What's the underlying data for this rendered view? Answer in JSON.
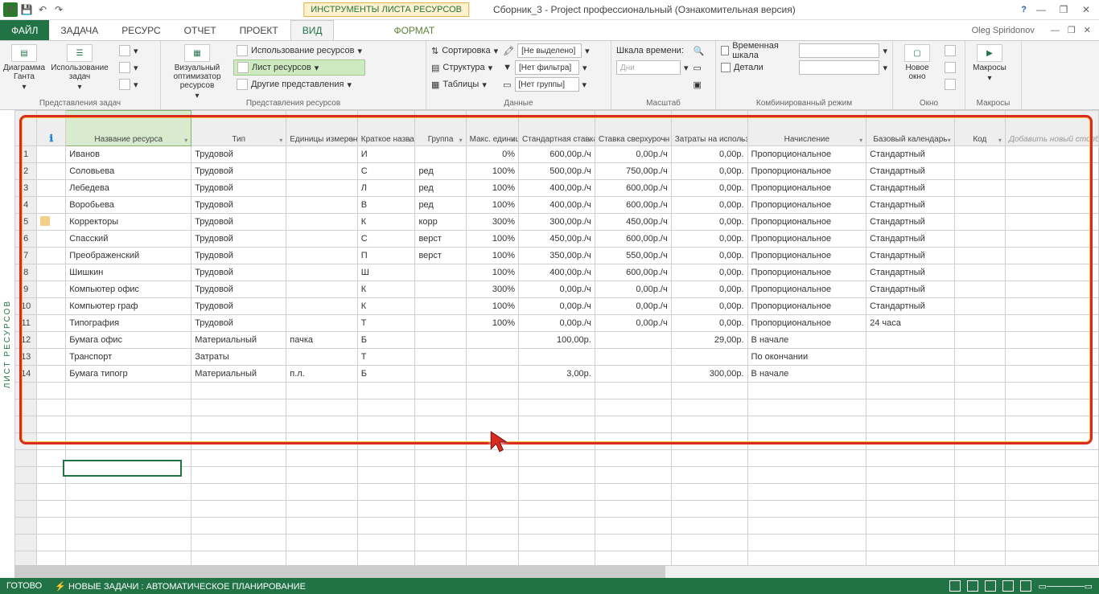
{
  "title": {
    "context_tab": "ИНСТРУМЕНТЫ ЛИСТА РЕСУРСОВ",
    "document": "Сборник_3 - Project профессиональный (Ознакомительная версия)"
  },
  "user": {
    "name": "Oleg Spiridonov"
  },
  "tabs": {
    "file": "ФАЙЛ",
    "items": [
      "ЗАДАЧА",
      "РЕСУРС",
      "ОТЧЕТ",
      "ПРОЕКТ",
      "ВИД",
      "",
      "ФОРМАТ"
    ]
  },
  "ribbon": {
    "g1": {
      "gantt": "Диаграмма Ганта",
      "usage": "Использование задач",
      "label": "Представления задач"
    },
    "g2": {
      "visual": "Визуальный оптимизатор ресурсов",
      "res_use": "Использование ресурсов",
      "res_sheet": "Лист ресурсов",
      "other": "Другие представления",
      "label": "Представления ресурсов"
    },
    "g3": {
      "sort": "Сортировка",
      "struct": "Структура",
      "tables": "Таблицы",
      "none": "[Не выделено]",
      "nofilter": "[Нет фильтра]",
      "nogroup": "[Нет группы]",
      "label": "Данные"
    },
    "g4": {
      "scale": "Шкала времени:",
      "days": "Дни",
      "label": "Масштаб"
    },
    "g5": {
      "timeline": "Временная шкала",
      "details": "Детали",
      "label": "Комбинированный режим"
    },
    "g6": {
      "new_window": "Новое окно",
      "label": "Окно"
    },
    "g7": {
      "macros": "Макросы",
      "label": "Макросы"
    }
  },
  "side": "ЛИСТ РЕСУРСОВ",
  "columns": [
    "",
    "",
    "Название ресурса",
    "Тип",
    "Единицы измерения материалов",
    "Краткое названи",
    "Группа",
    "Макс. единиц",
    "Стандартная ставка",
    "Ставка сверхурочн",
    "Затраты на использ.",
    "Начисление",
    "Базовый календарь",
    "Код",
    "Добавить новый столбец"
  ],
  "rows": [
    {
      "n": 1,
      "i": "",
      "name": "Иванов",
      "type": "Трудовой",
      "unit": "",
      "short": "И",
      "grp": "",
      "max": "0%",
      "std": "600,00р./ч",
      "over": "0,00р./ч",
      "cost": "0,00р.",
      "acc": "Пропорциональное",
      "cal": "Стандартный"
    },
    {
      "n": 2,
      "i": "",
      "name": "Соловьева",
      "type": "Трудовой",
      "unit": "",
      "short": "С",
      "grp": "ред",
      "max": "100%",
      "std": "500,00р./ч",
      "over": "750,00р./ч",
      "cost": "0,00р.",
      "acc": "Пропорциональное",
      "cal": "Стандартный"
    },
    {
      "n": 3,
      "i": "",
      "name": "Лебедева",
      "type": "Трудовой",
      "unit": "",
      "short": "Л",
      "grp": "ред",
      "max": "100%",
      "std": "400,00р./ч",
      "over": "600,00р./ч",
      "cost": "0,00р.",
      "acc": "Пропорциональное",
      "cal": "Стандартный"
    },
    {
      "n": 4,
      "i": "",
      "name": "Воробьева",
      "type": "Трудовой",
      "unit": "",
      "short": "В",
      "grp": "ред",
      "max": "100%",
      "std": "400,00р./ч",
      "over": "600,00р./ч",
      "cost": "0,00р.",
      "acc": "Пропорциональное",
      "cal": "Стандартный"
    },
    {
      "n": 5,
      "i": "ind",
      "name": "Корректоры",
      "type": "Трудовой",
      "unit": "",
      "short": "К",
      "grp": "корр",
      "max": "300%",
      "std": "300,00р./ч",
      "over": "450,00р./ч",
      "cost": "0,00р.",
      "acc": "Пропорциональное",
      "cal": "Стандартный"
    },
    {
      "n": 6,
      "i": "",
      "name": "Спасский",
      "type": "Трудовой",
      "unit": "",
      "short": "С",
      "grp": "верст",
      "max": "100%",
      "std": "450,00р./ч",
      "over": "600,00р./ч",
      "cost": "0,00р.",
      "acc": "Пропорциональное",
      "cal": "Стандартный"
    },
    {
      "n": 7,
      "i": "",
      "name": "Преображенский",
      "type": "Трудовой",
      "unit": "",
      "short": "П",
      "grp": "верст",
      "max": "100%",
      "std": "350,00р./ч",
      "over": "550,00р./ч",
      "cost": "0,00р.",
      "acc": "Пропорциональное",
      "cal": "Стандартный"
    },
    {
      "n": 8,
      "i": "",
      "name": "Шишкин",
      "type": "Трудовой",
      "unit": "",
      "short": "Ш",
      "grp": "",
      "max": "100%",
      "std": "400,00р./ч",
      "over": "600,00р./ч",
      "cost": "0,00р.",
      "acc": "Пропорциональное",
      "cal": "Стандартный"
    },
    {
      "n": 9,
      "i": "",
      "name": "Компьютер офис",
      "type": "Трудовой",
      "unit": "",
      "short": "К",
      "grp": "",
      "max": "300%",
      "std": "0,00р./ч",
      "over": "0,00р./ч",
      "cost": "0,00р.",
      "acc": "Пропорциональное",
      "cal": "Стандартный"
    },
    {
      "n": 10,
      "i": "",
      "name": "Компьютер граф",
      "type": "Трудовой",
      "unit": "",
      "short": "К",
      "grp": "",
      "max": "100%",
      "std": "0,00р./ч",
      "over": "0,00р./ч",
      "cost": "0,00р.",
      "acc": "Пропорциональное",
      "cal": "Стандартный"
    },
    {
      "n": 11,
      "i": "",
      "name": "Типография",
      "type": "Трудовой",
      "unit": "",
      "short": "Т",
      "grp": "",
      "max": "100%",
      "std": "0,00р./ч",
      "over": "0,00р./ч",
      "cost": "0,00р.",
      "acc": "Пропорциональное",
      "cal": "24 часа"
    },
    {
      "n": 12,
      "i": "",
      "name": "Бумага офис",
      "type": "Материальный",
      "unit": "пачка",
      "short": "Б",
      "grp": "",
      "max": "",
      "std": "100,00р.",
      "over": "",
      "cost": "29,00р.",
      "acc": "В начале",
      "cal": ""
    },
    {
      "n": 13,
      "i": "",
      "name": "Транспорт",
      "type": "Затраты",
      "unit": "",
      "short": "Т",
      "grp": "",
      "max": "",
      "std": "",
      "over": "",
      "cost": "",
      "acc": "По окончании",
      "cal": ""
    },
    {
      "n": 14,
      "i": "",
      "name": "Бумага типогр",
      "type": "Материальный",
      "unit": "п.л.",
      "short": "Б",
      "grp": "",
      "max": "",
      "std": "3,00р.",
      "over": "",
      "cost": "300,00р.",
      "acc": "В начале",
      "cal": ""
    }
  ],
  "status": {
    "ready": "ГОТОВО",
    "auto": "НОВЫЕ ЗАДАЧИ : АВТОМАТИЧЕСКОЕ ПЛАНИРОВАНИЕ"
  }
}
